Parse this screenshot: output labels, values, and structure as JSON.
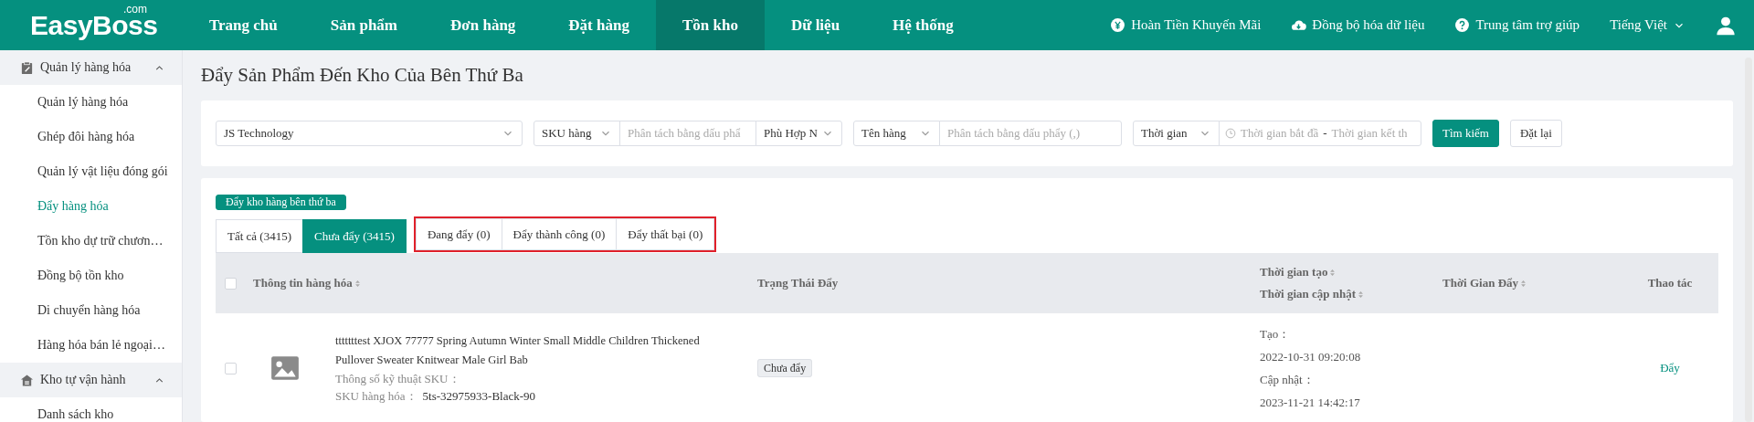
{
  "logo": {
    "text": "EasyBoss",
    "suffix": ".com"
  },
  "nav": [
    {
      "label": "Trang chủ",
      "selected": false
    },
    {
      "label": "Sản phẩm",
      "selected": false
    },
    {
      "label": "Đơn hàng",
      "selected": false
    },
    {
      "label": "Đặt hàng",
      "selected": false
    },
    {
      "label": "Tồn kho",
      "selected": true
    },
    {
      "label": "Dữ liệu",
      "selected": false
    },
    {
      "label": "Hệ thống",
      "selected": false
    }
  ],
  "header_links": [
    {
      "kind": "coin",
      "label": "Hoàn Tiền Khuyến Mãi"
    },
    {
      "kind": "cloud",
      "label": "Đồng bộ hóa dữ liệu"
    },
    {
      "kind": "help",
      "label": "Trung tâm trợ giúp"
    }
  ],
  "language": "Tiếng Việt",
  "sidebar": [
    {
      "kind": "clipboard",
      "label": "Quản lý hàng hóa",
      "expanded": true,
      "children": [
        {
          "label": "Quản lý hàng hóa",
          "selected": false
        },
        {
          "label": "Ghép đôi hàng hóa",
          "selected": false
        },
        {
          "label": "Quản lý vật liệu đóng gói",
          "selected": false
        },
        {
          "label": "Đẩy hàng hóa",
          "selected": true
        },
        {
          "label": "Tồn kho dự trữ chươn…",
          "selected": false
        },
        {
          "label": "Đồng bộ tồn kho",
          "selected": false
        },
        {
          "label": "Di chuyển hàng hóa",
          "selected": false
        },
        {
          "label": "Hàng hóa bán lẻ ngoại…",
          "selected": false
        }
      ]
    },
    {
      "kind": "house",
      "label": "Kho tự vận hành",
      "expanded": true,
      "children": [
        {
          "label": "Danh sách kho",
          "selected": false
        }
      ]
    }
  ],
  "page_title": "Đẩy Sản Phẩm Đến Kho Của Bên Thứ Ba",
  "filters": [
    {
      "kind": "select",
      "value": "JS Technology"
    },
    {
      "kind": "group",
      "parts": [
        {
          "kind": "select",
          "value": "SKU hàng"
        },
        {
          "kind": "input",
          "placeholder": "Phân tách bằng dấu phẩ"
        },
        {
          "kind": "select",
          "value": "Phù Hợp N"
        }
      ]
    },
    {
      "kind": "group",
      "parts": [
        {
          "kind": "select",
          "value": "Tên hàng"
        },
        {
          "kind": "input",
          "placeholder": "Phân tách bằng dấu phẩy (,)"
        }
      ]
    },
    {
      "kind": "group",
      "parts": [
        {
          "kind": "select",
          "value": "Thời gian"
        },
        {
          "kind": "daterange",
          "start": "Thời gian bắt đầ",
          "separator": "-",
          "end": "Thời gian kết th"
        }
      ]
    },
    {
      "kind": "button",
      "primary": true,
      "label": "Tìm kiếm"
    },
    {
      "kind": "button",
      "primary": false,
      "label": "Đặt lại"
    }
  ],
  "push_button": "Đẩy kho hàng bên thứ ba",
  "tabs": [
    {
      "label": "Tất cả (3415)",
      "selected": false,
      "outlined": false
    },
    {
      "label": "Chưa đẩy (3415)",
      "selected": true,
      "outlined": false
    },
    {
      "label": "Đang đẩy (0)",
      "selected": false,
      "outlined": true
    },
    {
      "label": "Đẩy thành công (0)",
      "selected": false,
      "outlined": true
    },
    {
      "label": "Đẩy thất bại (0)",
      "selected": false,
      "outlined": true
    }
  ],
  "table": {
    "select_all": false,
    "columns": [
      {
        "kind": "info",
        "lines": [
          {
            "label": "Thông tin hàng hóa",
            "sortable": true
          }
        ]
      },
      {
        "kind": "status",
        "lines": [
          {
            "label": "Trạng Thái Đẩy",
            "sortable": false
          }
        ]
      },
      {
        "kind": "time",
        "lines": [
          {
            "label": "Thời gian tạo",
            "sortable": true
          },
          {
            "label": "Thời gian cập nhật",
            "sortable": true
          }
        ]
      },
      {
        "kind": "pushed",
        "lines": [
          {
            "label": "Thời Gian Đẩy",
            "sortable": true
          }
        ]
      },
      {
        "kind": "action",
        "lines": [
          {
            "label": "Thao tác",
            "sortable": false
          }
        ]
      }
    ],
    "rows": [
      {
        "selected": false,
        "title": "tttttttest XJOX 77777 Spring Autumn Winter Small Middle Children Thickened Pullover Sweater Knitwear Male Girl Bab",
        "spec_label": "Thông số kỹ thuật SKU：",
        "sku_label": "SKU hàng hóa：",
        "sku": "5ts-32975933-Black-90",
        "status": "Chưa đẩy",
        "created_label": "Tạo：",
        "created": "2022-10-31 09:20:08",
        "updated_label": "Cập nhật：",
        "updated": "2023-11-21 14:42:17",
        "action": "Đẩy"
      }
    ]
  }
}
